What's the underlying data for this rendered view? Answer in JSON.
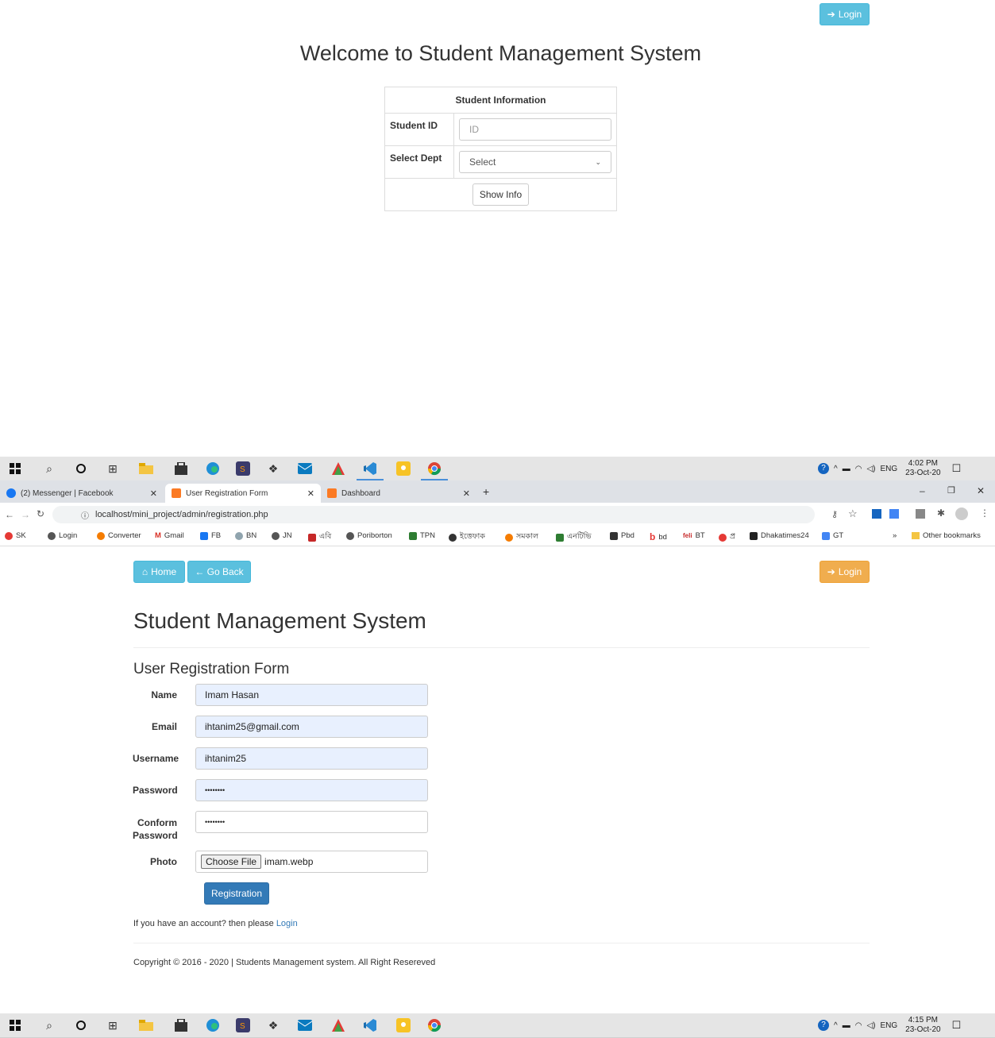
{
  "top_page": {
    "login_label": "Login",
    "welcome_title": "Welcome to Student Management System",
    "table_header": "Student Information",
    "student_id_label": "Student ID",
    "student_id_placeholder": "ID",
    "select_dept_label": "Select Dept",
    "select_dept_value": "Select",
    "show_info_label": "Show Info"
  },
  "taskbar_top": {
    "time": "4:02 PM",
    "date": "23-Oct-20",
    "lang": "ENG"
  },
  "taskbar_bottom": {
    "time": "4:15 PM",
    "date": "23-Oct-20",
    "lang": "ENG"
  },
  "browser": {
    "tabs": [
      {
        "title": "(2) Messenger | Facebook",
        "active": false
      },
      {
        "title": "User Registration Form",
        "active": true
      },
      {
        "title": "Dashboard",
        "active": false
      }
    ],
    "url": "localhost/mini_project/admin/registration.php",
    "bookmarks": [
      "SK",
      "Login",
      "Converter",
      "Gmail",
      "FB",
      "BN",
      "JN",
      "এবি",
      "Poriborton",
      "TPN",
      "ইত্তেফাক",
      "সমকাল",
      "এনটিভি",
      "Pbd",
      "bd",
      "BT",
      "প্র",
      "Dhakatimes24",
      "GT"
    ],
    "more_bookmarks": "»",
    "other_bookmarks": "Other bookmarks"
  },
  "registration_page": {
    "home_label": "Home",
    "go_back_label": "← Go Back",
    "login_label": "Login",
    "title": "Student Management System",
    "form_title": "User Registration Form",
    "fields": {
      "name_label": "Name",
      "name_value": "Imam Hasan",
      "email_label": "Email",
      "email_value": "ihtanim25@gmail.com",
      "username_label": "Username",
      "username_value": "ihtanim25",
      "password_label": "Password",
      "password_value": "••••••••",
      "confirm_label_1": "Conform",
      "confirm_label_2": "Password",
      "confirm_value": "••••••••",
      "photo_label": "Photo",
      "choose_file": "Choose File",
      "file_name": "imam.webp"
    },
    "submit_label": "Registration",
    "account_text": "If you have an account? then please",
    "account_link": "Login",
    "footer": "Copyright © 2016 - 2020 | Students Management system. All Right Resereved"
  }
}
